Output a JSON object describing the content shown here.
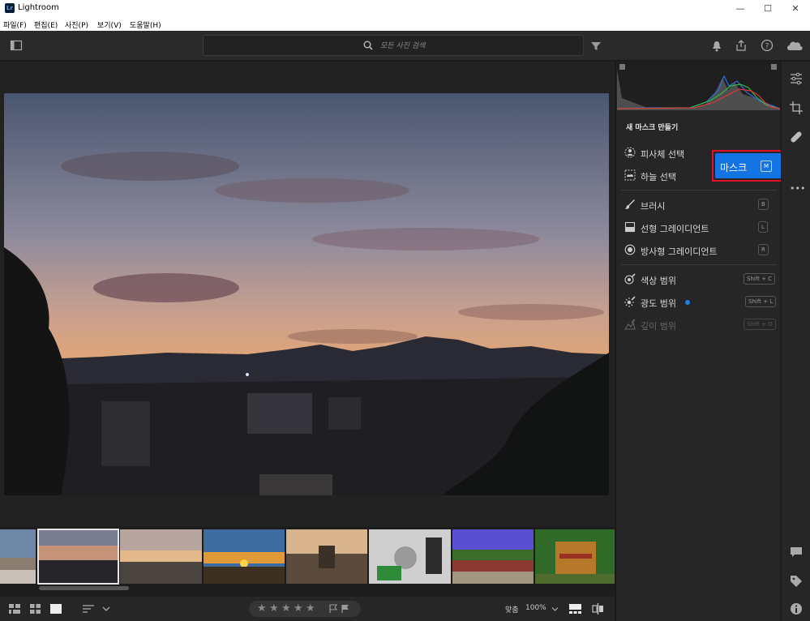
{
  "window": {
    "title": "Lightroom",
    "app_icon_text": "Lr",
    "controls": [
      "—",
      "☐",
      "✕"
    ]
  },
  "menu": [
    "파일(F)",
    "편집(E)",
    "사진(P)",
    "보기(V)",
    "도움말(H)"
  ],
  "toolbar": {
    "search_placeholder": "모든 사진 검색"
  },
  "panel": {
    "title": "새 마스크 만들기",
    "tools": [
      {
        "label": "피사체 선택",
        "icon": "subject-icon"
      },
      {
        "label": "하늘 선택",
        "icon": "sky-icon"
      },
      {
        "label": "브러시",
        "icon": "brush-icon",
        "key": "B"
      },
      {
        "label": "선형 그레이디언트",
        "icon": "linear-gradient-icon",
        "key": "L"
      },
      {
        "label": "방사형 그레이디언트",
        "icon": "radial-gradient-icon",
        "key": "R"
      },
      {
        "label": "색상 범위",
        "icon": "color-range-icon",
        "key": "Shift + C"
      },
      {
        "label": "광도 범위",
        "icon": "luminance-range-icon",
        "key": "Shift + L"
      },
      {
        "label": "깊이 범위",
        "icon": "depth-range-icon",
        "key": "Shift + D",
        "disabled": true
      }
    ]
  },
  "mask_button": {
    "label": "마스크",
    "key": "M"
  },
  "bottombar": {
    "stars": [
      "★",
      "★",
      "★",
      "★",
      "★"
    ],
    "fit_label": "맞춤",
    "zoom_label": "100%"
  },
  "colors": {
    "accent": "#1474e4",
    "highlight_border": "#e0102a",
    "panel_bg": "#262626"
  }
}
